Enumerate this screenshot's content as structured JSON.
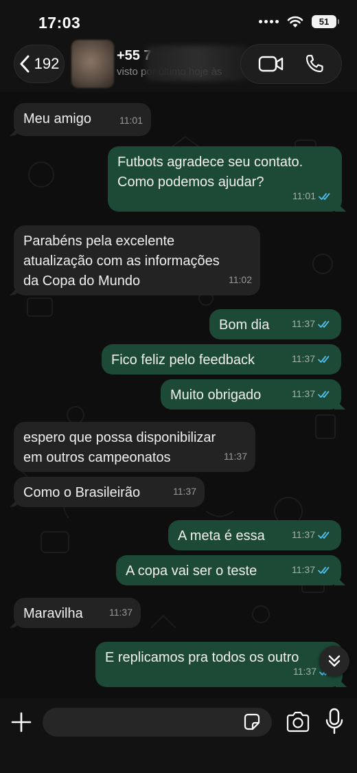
{
  "status_bar": {
    "time": "17:03",
    "battery": "51"
  },
  "header": {
    "back_count": "192",
    "contact_name": "+55 7",
    "last_seen": "visto por último hoje às"
  },
  "messages": [
    {
      "dir": "in",
      "text": "Meu amigo",
      "time": "11:01"
    },
    {
      "dir": "out",
      "text": "Futbots agradece seu contato.\nComo podemos ajudar?",
      "time": "11:01"
    },
    {
      "dir": "in",
      "text": "Parabéns pela excelente\natualização com as informações\nda Copa do Mundo",
      "time": "11:02"
    },
    {
      "dir": "out",
      "text": "Bom dia",
      "time": "11:37"
    },
    {
      "dir": "out",
      "text": "Fico feliz pelo feedback",
      "time": "11:37"
    },
    {
      "dir": "out",
      "text": "Muito obrigado",
      "time": "11:37"
    },
    {
      "dir": "in",
      "text": "espero que possa disponibilizar\nem outros campeonatos",
      "time": "11:37"
    },
    {
      "dir": "in",
      "text": "Como o Brasileirão",
      "time": "11:37"
    },
    {
      "dir": "out",
      "text": "A meta é essa",
      "time": "11:37"
    },
    {
      "dir": "out",
      "text": "A copa vai ser o teste",
      "time": "11:37"
    },
    {
      "dir": "in",
      "text": "Maravilha",
      "time": "11:37"
    },
    {
      "dir": "out",
      "text": "E replicamos pra todos os outro",
      "time": "11:37"
    }
  ],
  "colors": {
    "incoming_bubble": "#232323",
    "outgoing_bubble": "#1d4a36",
    "read_ticks": "#53bdeb"
  }
}
